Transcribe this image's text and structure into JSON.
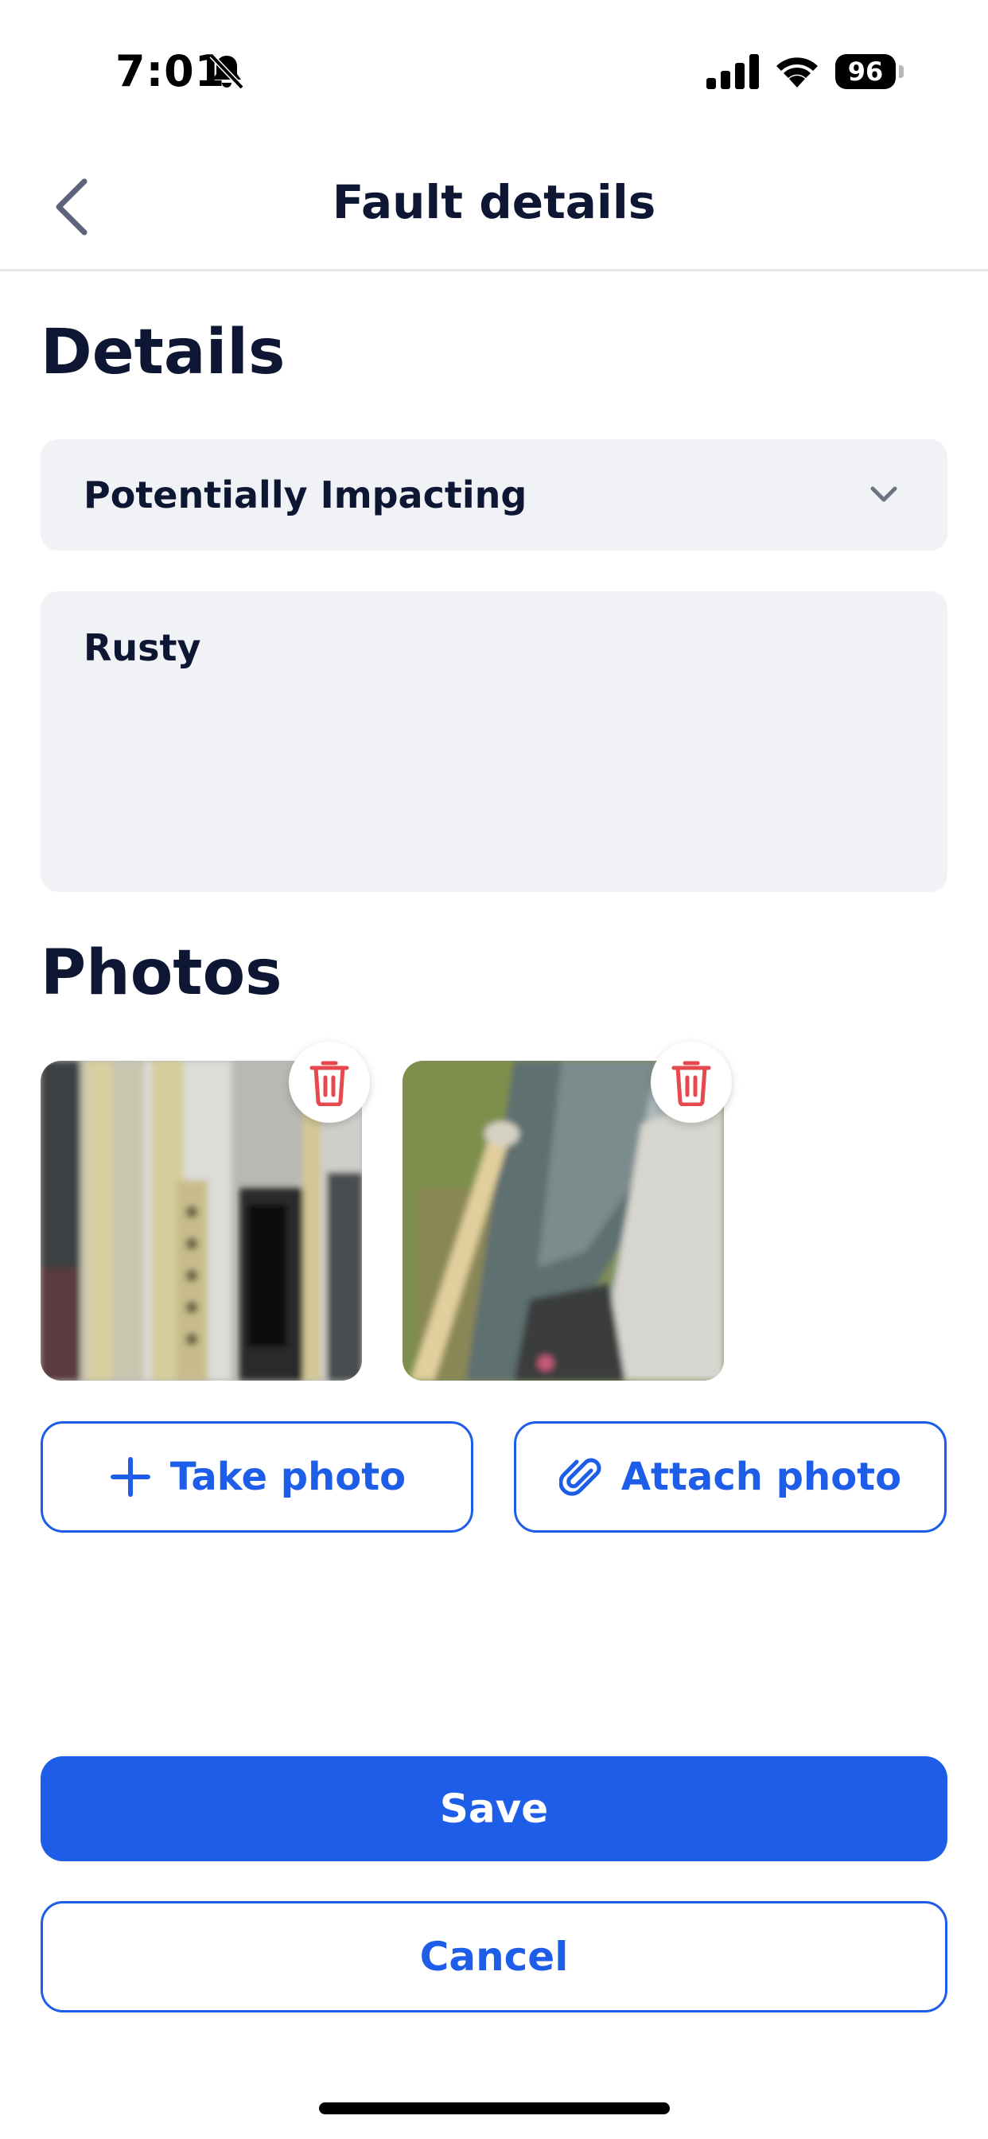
{
  "status_bar": {
    "time": "7:01",
    "battery_level": "96",
    "icons": [
      "bell-slash-icon",
      "signal-icon",
      "wifi-icon",
      "battery-icon"
    ]
  },
  "header": {
    "title": "Fault details",
    "back_icon": "chevron-left-icon"
  },
  "details": {
    "section_title": "Details",
    "impact_select": {
      "value": "Potentially Impacting",
      "icon": "chevron-down-icon"
    },
    "description": {
      "value": "Rusty"
    }
  },
  "photos": {
    "section_title": "Photos",
    "items": [
      {
        "name": "photo-1",
        "delete_icon": "trash-icon"
      },
      {
        "name": "photo-2",
        "delete_icon": "trash-icon"
      }
    ],
    "take_photo_label": "Take photo",
    "attach_photo_label": "Attach photo"
  },
  "actions": {
    "save_label": "Save",
    "cancel_label": "Cancel"
  },
  "colors": {
    "accent": "#1d5de8",
    "danger": "#e5484d",
    "field_bg": "#f1f2f6",
    "text_primary": "#0d1733"
  }
}
